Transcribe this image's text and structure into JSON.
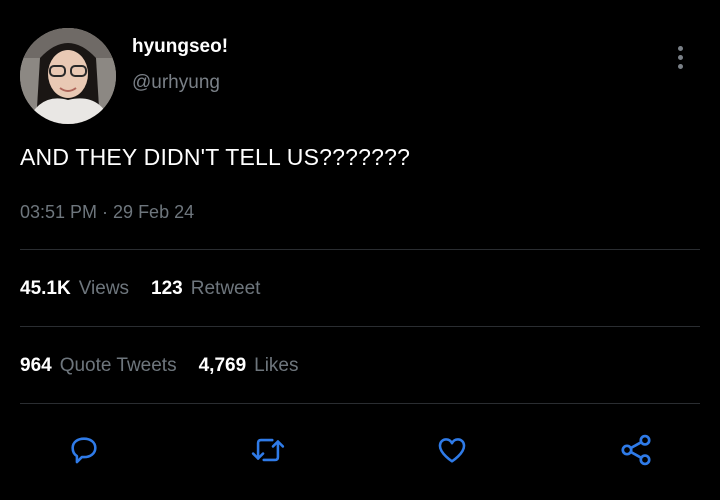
{
  "user": {
    "display_name": "hyungseo!",
    "handle": "@urhyung"
  },
  "tweet": {
    "text": "AND THEY DIDN'T TELL US???????",
    "timestamp": "03:51 PM · 29 Feb 24"
  },
  "stats_row1": [
    {
      "value": "45.1K",
      "label": "Views"
    },
    {
      "value": "123",
      "label": "Retweet"
    }
  ],
  "stats_row2": [
    {
      "value": "964",
      "label": "Quote Tweets"
    },
    {
      "value": "4,769",
      "label": "Likes"
    }
  ],
  "actions": [
    "reply-icon",
    "retweet-icon",
    "like-icon",
    "share-icon"
  ],
  "colors": {
    "background": "#000000",
    "muted": "#6e767d",
    "icon": "#2f7be8"
  }
}
